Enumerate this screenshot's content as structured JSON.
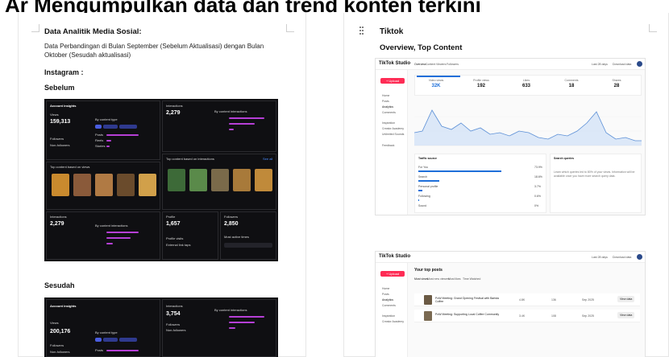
{
  "banner": {
    "text": "Ar Mengumpulkan data dan trend konten terkini"
  },
  "left_page": {
    "heading": "Data Analitik Media Sosial:",
    "paragraph": "Data Perbandingan di Bulan September (Sebelum Aktualisasi) dengan Bulan Oktober (Sesudah aktualisasi)",
    "platform": "Instagram :",
    "before_label": "Sebelum",
    "after_label": "Sesudah"
  },
  "ig_before": {
    "account_title": "Account insights",
    "views_label": "Views",
    "views_value": "159,313",
    "by_content_type": "By content type",
    "interactions_label": "Interactions",
    "interactions_value": "2,279",
    "by_content_interactions": "By content interactions",
    "top_content_views": "Top content based on views",
    "top_content_interactions": "Top content based on interactions",
    "interactions2_label": "Interactions",
    "interactions2_value": "2,279",
    "profile_label": "Profile",
    "profile_value": "1,657",
    "followers_label": "Followers",
    "followers_value": "2,850",
    "followers_row": "Followers",
    "non_followers_row": "Non-followers",
    "seg_all": "All",
    "seg_followers": "Followers",
    "seg_non": "Non-followers",
    "posts": "Posts",
    "reels": "Reels",
    "stories": "Stories",
    "profile_visits": "Profile visits",
    "external_taps": "External link taps",
    "most_active": "Most active times",
    "see_all": "See all"
  },
  "ig_after": {
    "account_title": "Account insights",
    "views_label": "Views",
    "views_value": "200,176",
    "by_content_type": "By content type",
    "interactions_label": "Interactions",
    "interactions_value": "3,754",
    "by_content_interactions": "By content interactions",
    "followers_row": "Followers",
    "non_followers_row": "Non-followers",
    "seg_all": "All",
    "seg_followers": "Followers",
    "seg_non": "Non-followers",
    "posts": "Posts",
    "reels": "Reels",
    "stories": "Stories"
  },
  "right_page": {
    "title": "Tiktok",
    "subtitle": "Overview, Top Content"
  },
  "tt_overview": {
    "logo": "TikTok Studio",
    "tabs": [
      "Overview",
      "Content",
      "Viewers",
      "Followers"
    ],
    "range": "Last 28 days",
    "download": "Download data",
    "upload": "+ Upload",
    "nav": [
      "Home",
      "Posts",
      "Analytics",
      "Comments",
      "Inspiration",
      "Creator Academy",
      "Unlimited Sounds",
      "Feedback"
    ],
    "kpis": [
      {
        "label": "Video views",
        "value": "32K"
      },
      {
        "label": "Profile views",
        "value": "192"
      },
      {
        "label": "Likes",
        "value": "633"
      },
      {
        "label": "Comments",
        "value": "18"
      },
      {
        "label": "Shares",
        "value": "28"
      }
    ],
    "traffic_title": "Traffic source",
    "search_title": "Search queries",
    "sources": [
      {
        "label": "For You",
        "pct": "73.9%",
        "value": 73.9
      },
      {
        "label": "Search",
        "pct": "18.6%",
        "value": 18.6
      },
      {
        "label": "Personal profile",
        "pct": "3.7%",
        "value": 3.7
      },
      {
        "label": "Following",
        "pct": "0.6%",
        "value": 0.6
      },
      {
        "label": "Sound",
        "pct": "0%",
        "value": 0
      }
    ],
    "search_note": "Learn which queries led to 80% of your views. Information will be available once you have more search query data."
  },
  "tt_content": {
    "logo": "TikTok Studio",
    "upload": "+ Upload",
    "range": "Last 28 days",
    "download": "Download data",
    "section_title": "Your top posts",
    "filters": [
      "Most views",
      "Most new viewers",
      "Most likes",
      "Time Watched"
    ],
    "nav": [
      "Home",
      "Posts",
      "Analytics",
      "Comments",
      "Inspiration",
      "Creator Academy"
    ],
    "posts": [
      {
        "title": "PoW Meeting: Grand Opening Festival with Barista Coffee",
        "views": "4.8K",
        "likes": "136",
        "date": "Sep 2025",
        "action": "View data"
      },
      {
        "title": "PoW Meeting: Supporting Local Coffee Community",
        "views": "3.4K",
        "likes": "108",
        "date": "Sep 2025",
        "action": "View data"
      }
    ]
  }
}
